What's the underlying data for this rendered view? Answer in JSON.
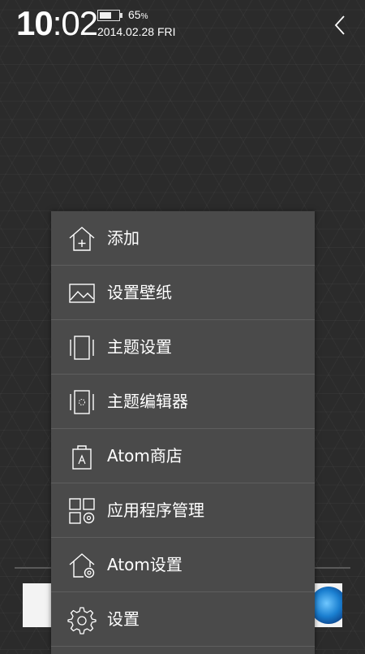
{
  "status": {
    "time_hour": "10",
    "time_sep": ":",
    "time_min": "02",
    "battery_level": 0.65,
    "battery_percent": "65",
    "battery_unit": "%",
    "date": "2014.02.28",
    "weekday": "FRI"
  },
  "menu": {
    "items": [
      {
        "label": "添加",
        "icon": "home-add-icon"
      },
      {
        "label": "设置壁纸",
        "icon": "wallpaper-icon"
      },
      {
        "label": "主题设置",
        "icon": "theme-icon"
      },
      {
        "label": "主题编辑器",
        "icon": "theme-editor-icon"
      },
      {
        "label": "Atom商店",
        "icon": "store-bag-icon"
      },
      {
        "label": "应用程序管理",
        "icon": "app-manage-icon"
      },
      {
        "label": "Atom设置",
        "icon": "home-settings-icon"
      },
      {
        "label": "设置",
        "icon": "gear-icon"
      }
    ]
  },
  "colors": {
    "background": "#2b2b2b",
    "menu_background": "#4a4a4a",
    "menu_divider": "#5e5e5e",
    "text": "#ffffff"
  }
}
